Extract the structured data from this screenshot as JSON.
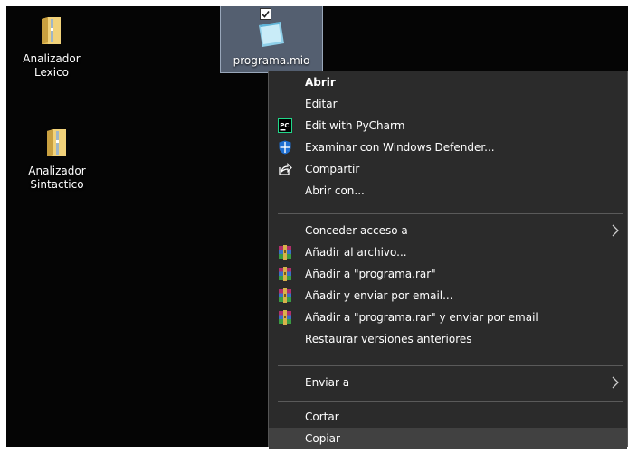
{
  "desktop": {
    "icons": [
      {
        "label": "Analizador Lexico"
      },
      {
        "label": "Analizador Sintactico"
      },
      {
        "label": "programa.mio"
      }
    ]
  },
  "context_menu": {
    "items": [
      {
        "label": "Abrir",
        "icon": "none"
      },
      {
        "label": "Editar",
        "icon": "none"
      },
      {
        "label": "Edit with PyCharm",
        "icon": "pycharm-icon"
      },
      {
        "label": "Examinar con Windows Defender...",
        "icon": "windows-defender-icon"
      },
      {
        "label": "Compartir",
        "icon": "share-icon"
      },
      {
        "label": "Abrir con...",
        "icon": "none"
      },
      {
        "label": "Conceder acceso a",
        "icon": "none",
        "submenu": true
      },
      {
        "label": "Añadir al archivo...",
        "icon": "winrar-icon"
      },
      {
        "label": "Añadir a \"programa.rar\"",
        "icon": "winrar-icon"
      },
      {
        "label": "Añadir y enviar por email...",
        "icon": "winrar-icon"
      },
      {
        "label": "Añadir a \"programa.rar\" y enviar por email",
        "icon": "winrar-icon"
      },
      {
        "label": "Restaurar versiones anteriores",
        "icon": "none"
      },
      {
        "label": "Enviar a",
        "icon": "none",
        "submenu": true
      },
      {
        "label": "Cortar",
        "icon": "none"
      },
      {
        "label": "Copiar",
        "icon": "none",
        "hovered": true
      }
    ]
  },
  "colors": {
    "desktop_bg": "#050505",
    "menu_bg": "#2b2b2b",
    "menu_hover": "#414141",
    "pycharm_green": "#21d789",
    "defender_blue": "#1f6fd1"
  }
}
